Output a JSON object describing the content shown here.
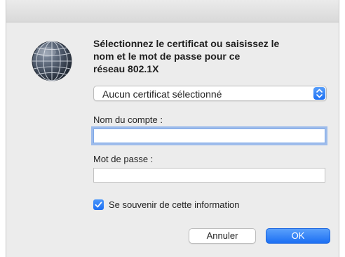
{
  "dialog": {
    "prompt_lines": [
      "Sélectionnez le certificat ou saisissez le",
      "nom et le mot de passe pour ce",
      "réseau 802.1X"
    ],
    "icon": "network-globe-icon"
  },
  "certificate": {
    "selected": "Aucun certificat sélectionné"
  },
  "account": {
    "label": "Nom du compte :",
    "value": ""
  },
  "password": {
    "label": "Mot de passe :",
    "value": ""
  },
  "remember": {
    "label": "Se souvenir de cette information",
    "checked": true
  },
  "buttons": {
    "cancel": "Annuler",
    "ok": "OK"
  },
  "colors": {
    "accent": "#1c6ff3",
    "window_bg": "#ececec",
    "focus_ring": "#5e96eb"
  }
}
